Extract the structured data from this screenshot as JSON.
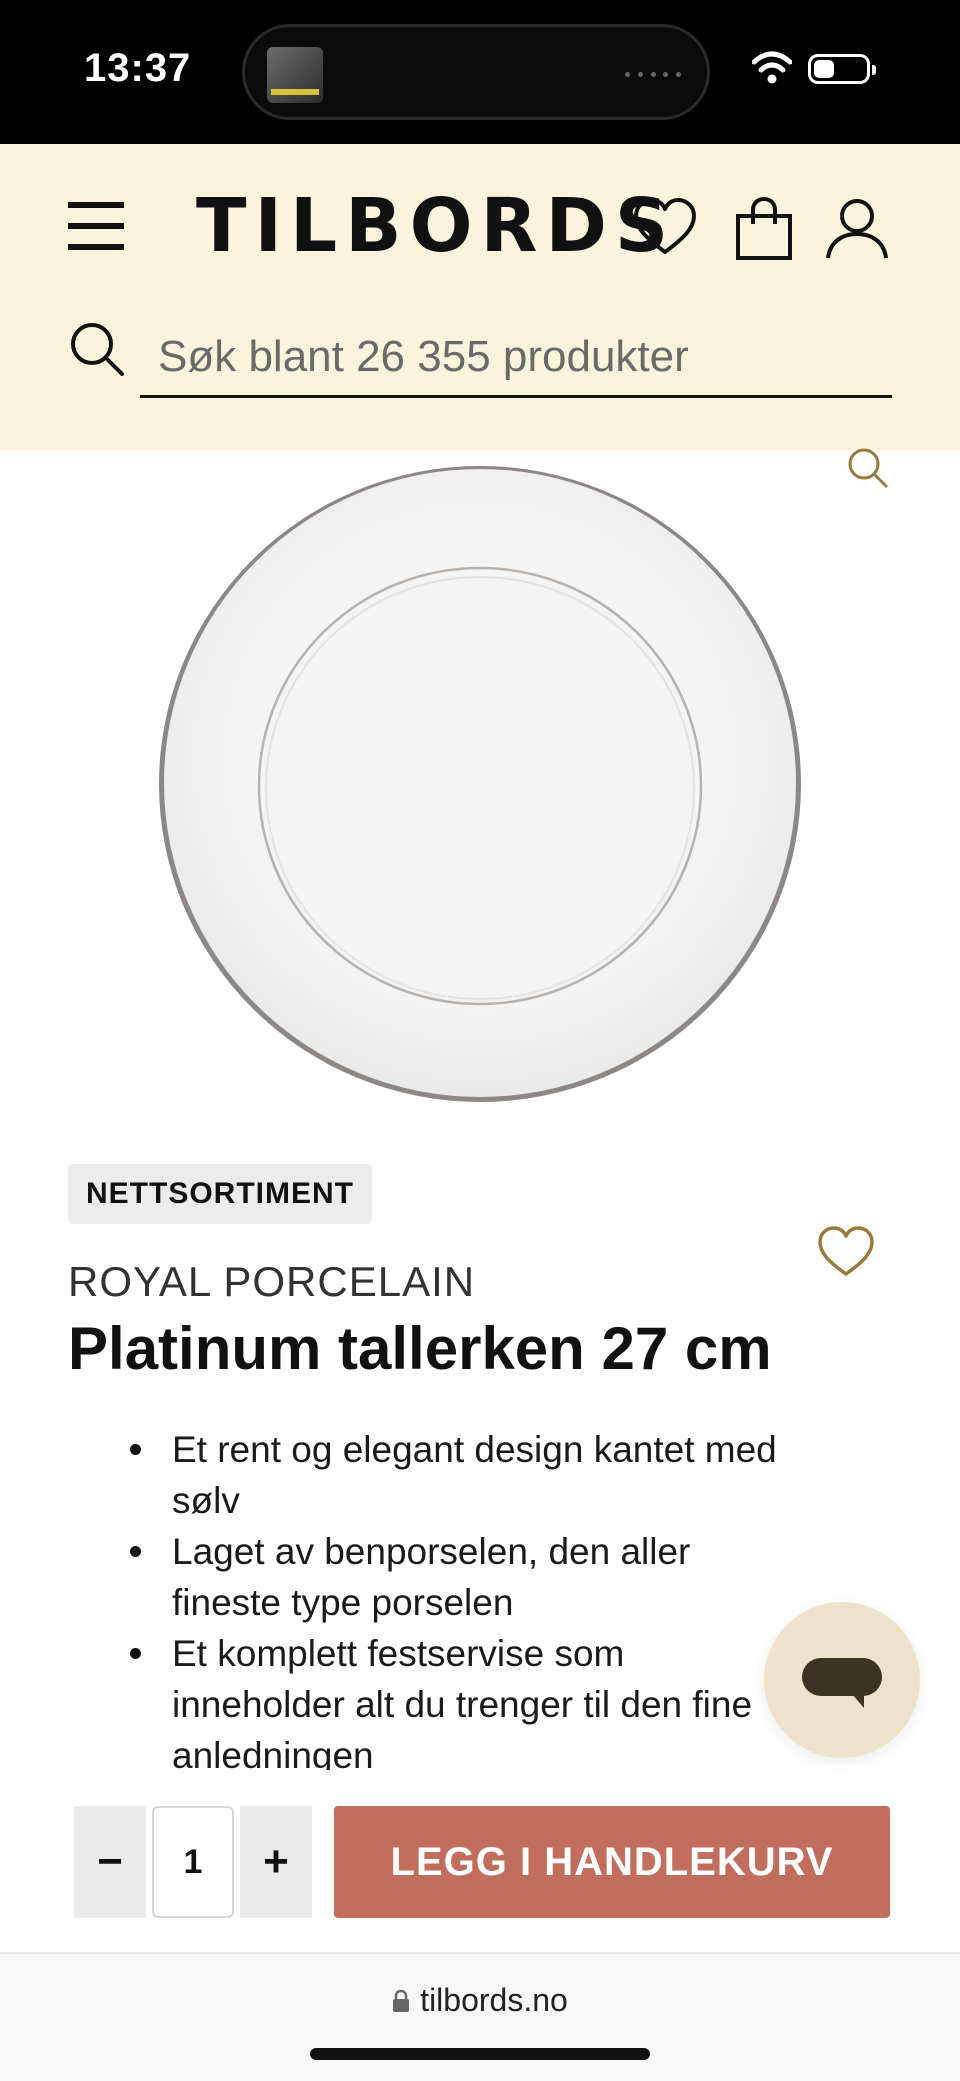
{
  "status_bar": {
    "time": "13:37"
  },
  "header": {
    "logo": "TILBORDS",
    "search_placeholder": "Søk blant 26 355 produkter",
    "background": "#fbf4dc"
  },
  "product": {
    "badge": "NETTSORTIMENT",
    "brand": "ROYAL PORCELAIN",
    "title": "Platinum tallerken 27 cm",
    "features": [
      "Et rent og elegant design kantet med sølv",
      "Laget av benporselen, den aller fineste type porselen",
      "Et komplett festservise som inneholder alt du trenger til den fine anledningen"
    ]
  },
  "cart": {
    "minus_label": "−",
    "quantity": "1",
    "plus_label": "+",
    "add_label": "LEGG I HANDLEKURV",
    "button_color": "#c26e5e"
  },
  "browser": {
    "url": "tilbords.no"
  },
  "icons": [
    "menu-icon",
    "heart-icon",
    "shopping-bag-icon",
    "user-icon",
    "search-icon",
    "zoom-icon",
    "chat-icon",
    "lock-icon"
  ],
  "colors": {
    "accent_gold": "#9a7a3c",
    "chat_bg": "#efe2cb",
    "chat_bubble": "#3d3322"
  }
}
